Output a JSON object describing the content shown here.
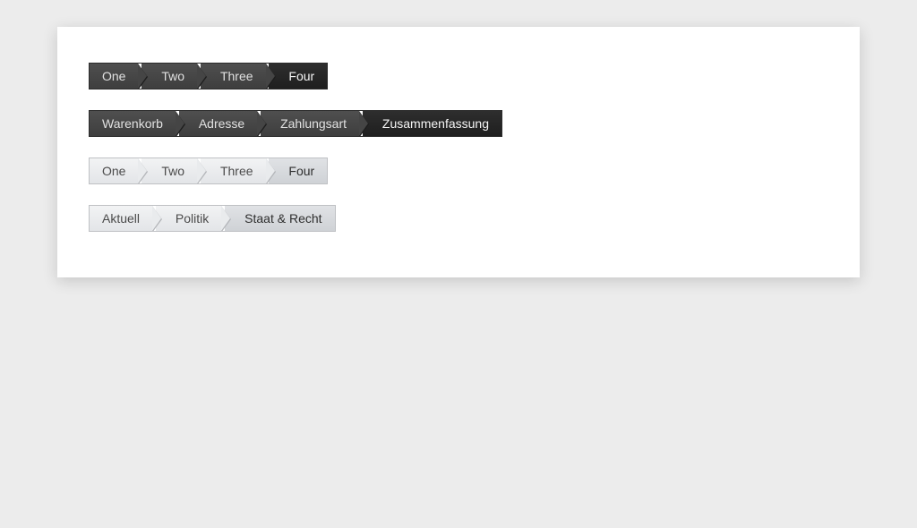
{
  "breadcrumbs": [
    {
      "variant": "dark",
      "activeIndex": 3,
      "items": [
        "One",
        "Two",
        "Three",
        "Four"
      ]
    },
    {
      "variant": "dark",
      "activeIndex": 3,
      "items": [
        "Warenkorb",
        "Adresse",
        "Zahlungsart",
        "Zusammenfassung"
      ]
    },
    {
      "variant": "light",
      "activeIndex": 3,
      "items": [
        "One",
        "Two",
        "Three",
        "Four"
      ]
    },
    {
      "variant": "light",
      "activeIndex": 2,
      "items": [
        "Aktuell",
        "Politik",
        "Staat & Recht"
      ]
    }
  ]
}
